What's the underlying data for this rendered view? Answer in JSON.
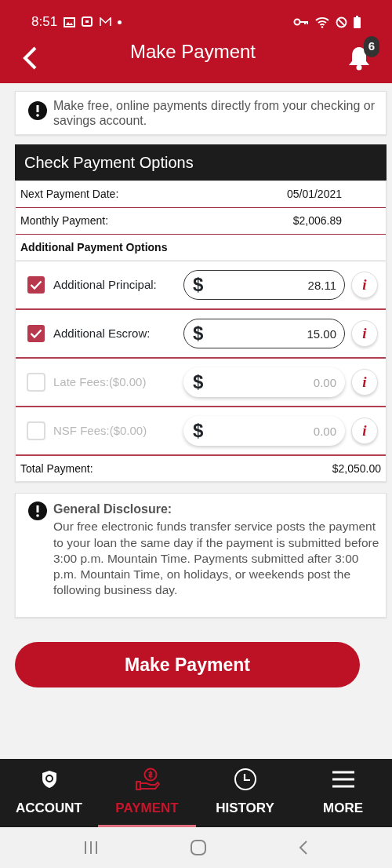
{
  "status_bar": {
    "time": "8:51"
  },
  "header": {
    "title": "Make Payment",
    "notifications": "6"
  },
  "notice": {
    "text": "Make free, online payments directly from your checking or savings account."
  },
  "section": {
    "title": "Check Payment Options"
  },
  "summary": [
    {
      "label": "Next Payment Date:",
      "value": "05/01/2021"
    },
    {
      "label": "Monthly Payment:",
      "value": "$2,006.89"
    }
  ],
  "options_heading": "Additional Payment Options",
  "options": [
    {
      "label": "Additional Principal:",
      "currency": "$",
      "value": "28.11",
      "checked": true,
      "disabled": false,
      "info": "i"
    },
    {
      "label": "Additional Escrow:",
      "currency": "$",
      "value": "15.00",
      "checked": true,
      "disabled": false,
      "info": "i"
    },
    {
      "label": "Late Fees:($0.00)",
      "currency": "$",
      "value": "0.00",
      "checked": false,
      "disabled": true,
      "info": "i"
    },
    {
      "label": "NSF Fees:($0.00)",
      "currency": "$",
      "value": "0.00",
      "checked": false,
      "disabled": true,
      "info": "i"
    }
  ],
  "total": {
    "label": "Total Payment:",
    "value": "$2,050.00"
  },
  "disclosure": {
    "title": "General Disclosure:",
    "text": "Our free electronic funds transfer service posts the payment to your loan the same day if the payment is submitted before 3:00 p.m. Mountain Time. Payments submitted after 3:00 p.m. Mountain Time, on holidays, or weekends post the following business day."
  },
  "submit": "Make Payment",
  "tabs": [
    {
      "label": "ACCOUNT",
      "selected": false
    },
    {
      "label": "PAYMENT",
      "selected": true
    },
    {
      "label": "HISTORY",
      "selected": false
    },
    {
      "label": "MORE",
      "selected": false
    }
  ]
}
